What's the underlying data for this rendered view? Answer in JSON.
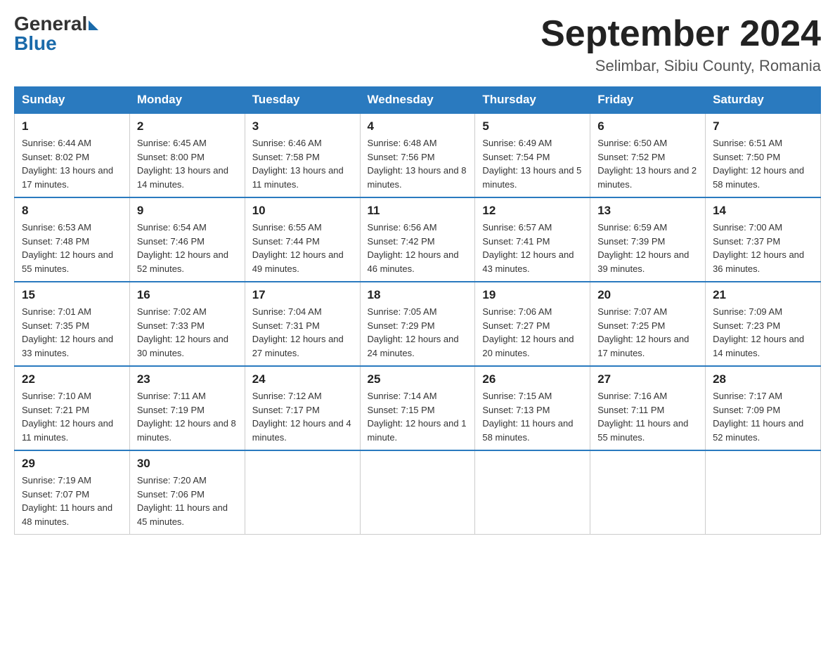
{
  "header": {
    "logo_general": "General",
    "logo_blue": "Blue",
    "month_title": "September 2024",
    "location": "Selimbar, Sibiu County, Romania"
  },
  "weekdays": [
    "Sunday",
    "Monday",
    "Tuesday",
    "Wednesday",
    "Thursday",
    "Friday",
    "Saturday"
  ],
  "weeks": [
    [
      {
        "day": "1",
        "sunrise": "6:44 AM",
        "sunset": "8:02 PM",
        "daylight": "13 hours and 17 minutes."
      },
      {
        "day": "2",
        "sunrise": "6:45 AM",
        "sunset": "8:00 PM",
        "daylight": "13 hours and 14 minutes."
      },
      {
        "day": "3",
        "sunrise": "6:46 AM",
        "sunset": "7:58 PM",
        "daylight": "13 hours and 11 minutes."
      },
      {
        "day": "4",
        "sunrise": "6:48 AM",
        "sunset": "7:56 PM",
        "daylight": "13 hours and 8 minutes."
      },
      {
        "day": "5",
        "sunrise": "6:49 AM",
        "sunset": "7:54 PM",
        "daylight": "13 hours and 5 minutes."
      },
      {
        "day": "6",
        "sunrise": "6:50 AM",
        "sunset": "7:52 PM",
        "daylight": "13 hours and 2 minutes."
      },
      {
        "day": "7",
        "sunrise": "6:51 AM",
        "sunset": "7:50 PM",
        "daylight": "12 hours and 58 minutes."
      }
    ],
    [
      {
        "day": "8",
        "sunrise": "6:53 AM",
        "sunset": "7:48 PM",
        "daylight": "12 hours and 55 minutes."
      },
      {
        "day": "9",
        "sunrise": "6:54 AM",
        "sunset": "7:46 PM",
        "daylight": "12 hours and 52 minutes."
      },
      {
        "day": "10",
        "sunrise": "6:55 AM",
        "sunset": "7:44 PM",
        "daylight": "12 hours and 49 minutes."
      },
      {
        "day": "11",
        "sunrise": "6:56 AM",
        "sunset": "7:42 PM",
        "daylight": "12 hours and 46 minutes."
      },
      {
        "day": "12",
        "sunrise": "6:57 AM",
        "sunset": "7:41 PM",
        "daylight": "12 hours and 43 minutes."
      },
      {
        "day": "13",
        "sunrise": "6:59 AM",
        "sunset": "7:39 PM",
        "daylight": "12 hours and 39 minutes."
      },
      {
        "day": "14",
        "sunrise": "7:00 AM",
        "sunset": "7:37 PM",
        "daylight": "12 hours and 36 minutes."
      }
    ],
    [
      {
        "day": "15",
        "sunrise": "7:01 AM",
        "sunset": "7:35 PM",
        "daylight": "12 hours and 33 minutes."
      },
      {
        "day": "16",
        "sunrise": "7:02 AM",
        "sunset": "7:33 PM",
        "daylight": "12 hours and 30 minutes."
      },
      {
        "day": "17",
        "sunrise": "7:04 AM",
        "sunset": "7:31 PM",
        "daylight": "12 hours and 27 minutes."
      },
      {
        "day": "18",
        "sunrise": "7:05 AM",
        "sunset": "7:29 PM",
        "daylight": "12 hours and 24 minutes."
      },
      {
        "day": "19",
        "sunrise": "7:06 AM",
        "sunset": "7:27 PM",
        "daylight": "12 hours and 20 minutes."
      },
      {
        "day": "20",
        "sunrise": "7:07 AM",
        "sunset": "7:25 PM",
        "daylight": "12 hours and 17 minutes."
      },
      {
        "day": "21",
        "sunrise": "7:09 AM",
        "sunset": "7:23 PM",
        "daylight": "12 hours and 14 minutes."
      }
    ],
    [
      {
        "day": "22",
        "sunrise": "7:10 AM",
        "sunset": "7:21 PM",
        "daylight": "12 hours and 11 minutes."
      },
      {
        "day": "23",
        "sunrise": "7:11 AM",
        "sunset": "7:19 PM",
        "daylight": "12 hours and 8 minutes."
      },
      {
        "day": "24",
        "sunrise": "7:12 AM",
        "sunset": "7:17 PM",
        "daylight": "12 hours and 4 minutes."
      },
      {
        "day": "25",
        "sunrise": "7:14 AM",
        "sunset": "7:15 PM",
        "daylight": "12 hours and 1 minute."
      },
      {
        "day": "26",
        "sunrise": "7:15 AM",
        "sunset": "7:13 PM",
        "daylight": "11 hours and 58 minutes."
      },
      {
        "day": "27",
        "sunrise": "7:16 AM",
        "sunset": "7:11 PM",
        "daylight": "11 hours and 55 minutes."
      },
      {
        "day": "28",
        "sunrise": "7:17 AM",
        "sunset": "7:09 PM",
        "daylight": "11 hours and 52 minutes."
      }
    ],
    [
      {
        "day": "29",
        "sunrise": "7:19 AM",
        "sunset": "7:07 PM",
        "daylight": "11 hours and 48 minutes."
      },
      {
        "day": "30",
        "sunrise": "7:20 AM",
        "sunset": "7:06 PM",
        "daylight": "11 hours and 45 minutes."
      },
      null,
      null,
      null,
      null,
      null
    ]
  ]
}
